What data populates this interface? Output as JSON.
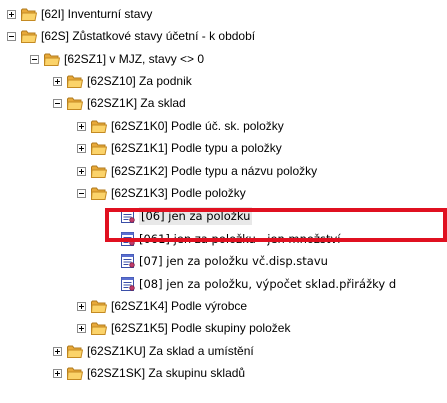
{
  "tree": {
    "n62I": "[62I]  Inventurní stavy",
    "n62S": "[62S]  Zůstatkové stavy účetní - k období",
    "n62SZ1": "[62SZ1]  v MJZ, stavy <> 0",
    "n62SZ10": "[62SZ10]  Za podnik",
    "n62SZ1K": "[62SZ1K]  Za sklad",
    "n62SZ1K0": "[62SZ1K0]  Podle úč. sk. položky",
    "n62SZ1K1": "[62SZ1K1]  Podle typu a položky",
    "n62SZ1K2": "[62SZ1K2]  Podle typu a názvu položky",
    "n62SZ1K3": "[62SZ1K3]  Podle položky",
    "r06": "[06] jen za položku",
    "r061": "[061] jen za položku - jen množství",
    "r07": "[07] jen za položku vč.disp.stavu",
    "r08": "[08] jen za položku, výpočet sklad.přirážky d",
    "n62SZ1K4": "[62SZ1K4]  Podle výrobce",
    "n62SZ1K5": "[62SZ1K5]  Podle skupiny položek",
    "n62SZ1KU": "[62SZ1KU]  Za sklad a umístění",
    "n62SZ1SK": "[62SZ1SK]  Za skupinu skladů"
  },
  "colors": {
    "highlight": "#e01020",
    "folder": "#f5c542"
  }
}
